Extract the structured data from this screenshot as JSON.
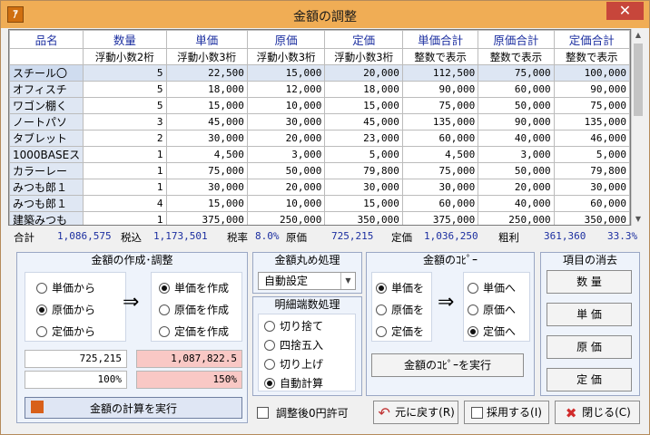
{
  "window": {
    "title": "金額の調整",
    "app_icon": "app-icon",
    "close_label": "✕"
  },
  "table": {
    "headers": [
      "品名",
      "数量",
      "単価",
      "原価",
      "定価",
      "単価合計",
      "原価合計",
      "定価合計"
    ],
    "subheaders": [
      "",
      "浮動小数2桁",
      "浮動小数3桁",
      "浮動小数3桁",
      "浮動小数3桁",
      "整数で表示",
      "整数で表示",
      "整数で表示"
    ],
    "rows": [
      [
        "スチール〇",
        "5",
        "22,500",
        "15,000",
        "20,000",
        "112,500",
        "75,000",
        "100,000"
      ],
      [
        "オフィスチ",
        "5",
        "18,000",
        "12,000",
        "18,000",
        "90,000",
        "60,000",
        "90,000"
      ],
      [
        "ワゴン棚く",
        "5",
        "15,000",
        "10,000",
        "15,000",
        "75,000",
        "50,000",
        "75,000"
      ],
      [
        "ノートパソ",
        "3",
        "45,000",
        "30,000",
        "45,000",
        "135,000",
        "90,000",
        "135,000"
      ],
      [
        "タブレット",
        "2",
        "30,000",
        "20,000",
        "23,000",
        "60,000",
        "40,000",
        "46,000"
      ],
      [
        "1000BASEス",
        "1",
        "4,500",
        "3,000",
        "5,000",
        "4,500",
        "3,000",
        "5,000"
      ],
      [
        "カラーレー",
        "1",
        "75,000",
        "50,000",
        "79,800",
        "75,000",
        "50,000",
        "79,800"
      ],
      [
        "みつも郎１",
        "1",
        "30,000",
        "20,000",
        "30,000",
        "30,000",
        "20,000",
        "30,000"
      ],
      [
        "みつも郎１",
        "4",
        "15,000",
        "10,000",
        "15,000",
        "60,000",
        "40,000",
        "60,000"
      ],
      [
        "建築みつも",
        "1",
        "375,000",
        "250,000",
        "350,000",
        "375,000",
        "250,000",
        "350,000"
      ]
    ]
  },
  "totals": {
    "goukei_label": "合計",
    "goukei": "1,086,575",
    "zeikomi_label": "税込",
    "zeikomi": "1,173,501",
    "rate_label": "税率",
    "rate": "8.0%",
    "genka_label": "原価",
    "genka": "725,215",
    "teika_label": "定価",
    "teika": "1,036,250",
    "arari_label": "粗利",
    "arari": "361,360",
    "arari_pct": "33.3%"
  },
  "calc_panel": {
    "title": "金額の作成･調整",
    "from_options": [
      "単価から",
      "原価から",
      "定価から"
    ],
    "from_selected": 1,
    "arrow": "⇒",
    "to_options": [
      "単価を作成",
      "原価を作成",
      "定価を作成"
    ],
    "to_selected": 0,
    "base_value": "725,215",
    "result_value": "1,087,822.5",
    "base_pct": "100%",
    "result_pct": "150%",
    "exec_label": "金額の計算を実行"
  },
  "rounding_panel": {
    "title": "金額丸め処理",
    "select_value": "自動設定",
    "detail_title": "明細端数処理",
    "options": [
      "切り捨て",
      "四捨五入",
      "切り上げ",
      "自動計算"
    ],
    "selected": 3
  },
  "copy_panel": {
    "title": "金額のｺﾋﾟｰ",
    "from_options": [
      "単価を",
      "原価を",
      "定価を"
    ],
    "from_selected": 0,
    "arrow": "⇒",
    "to_options": [
      "単価へ",
      "原価へ",
      "定価へ"
    ],
    "to_selected": 2,
    "exec_label": "金額のｺﾋﾟｰを実行"
  },
  "clear_panel": {
    "title": "項目の消去",
    "buttons": [
      "数 量",
      "単 価",
      "原 価",
      "定 価"
    ]
  },
  "footer": {
    "zero_allow_label": "調整後0円許可",
    "undo_label": "元に戻す(R)",
    "adopt_label": "採用する(I)",
    "close_label": "閉じる(C)"
  },
  "colors": {
    "title_bar": "#f0ad55",
    "header_text": "#1c2fa0",
    "pink_field": "#f9c8c5",
    "close_button": "#c7463b"
  }
}
